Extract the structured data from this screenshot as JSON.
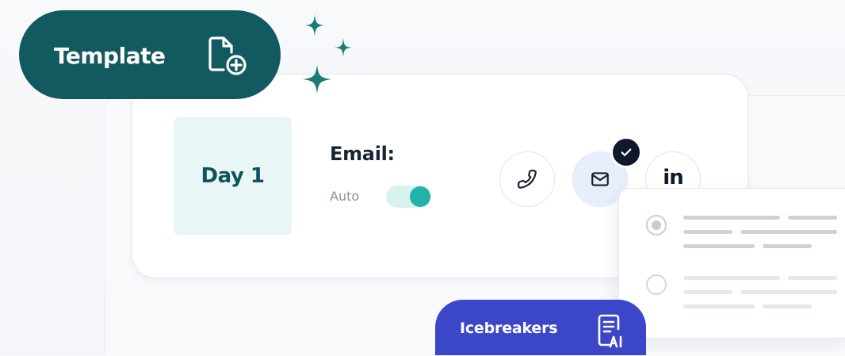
{
  "template_pill": {
    "label": "Template",
    "icon": "template-add-icon"
  },
  "step": {
    "day_label": "Day 1",
    "channel_label": "Email:",
    "mode_label": "Auto",
    "toggle_on": true
  },
  "channels": [
    {
      "name": "phone",
      "icon": "phone-icon"
    },
    {
      "name": "email",
      "icon": "mail-icon",
      "selected": true
    },
    {
      "name": "linkedin",
      "text": "in",
      "icon": "linkedin-icon"
    }
  ],
  "options_popup": {
    "options": [
      {
        "selected": true
      },
      {
        "selected": false
      }
    ]
  },
  "icebreakers_pill": {
    "label": "Icebreakers",
    "icon": "ai-document-icon"
  },
  "colors": {
    "teal_dark": "#135960",
    "teal_accent": "#23b3a6",
    "indigo": "#3b46c9",
    "navy": "#10182a"
  }
}
